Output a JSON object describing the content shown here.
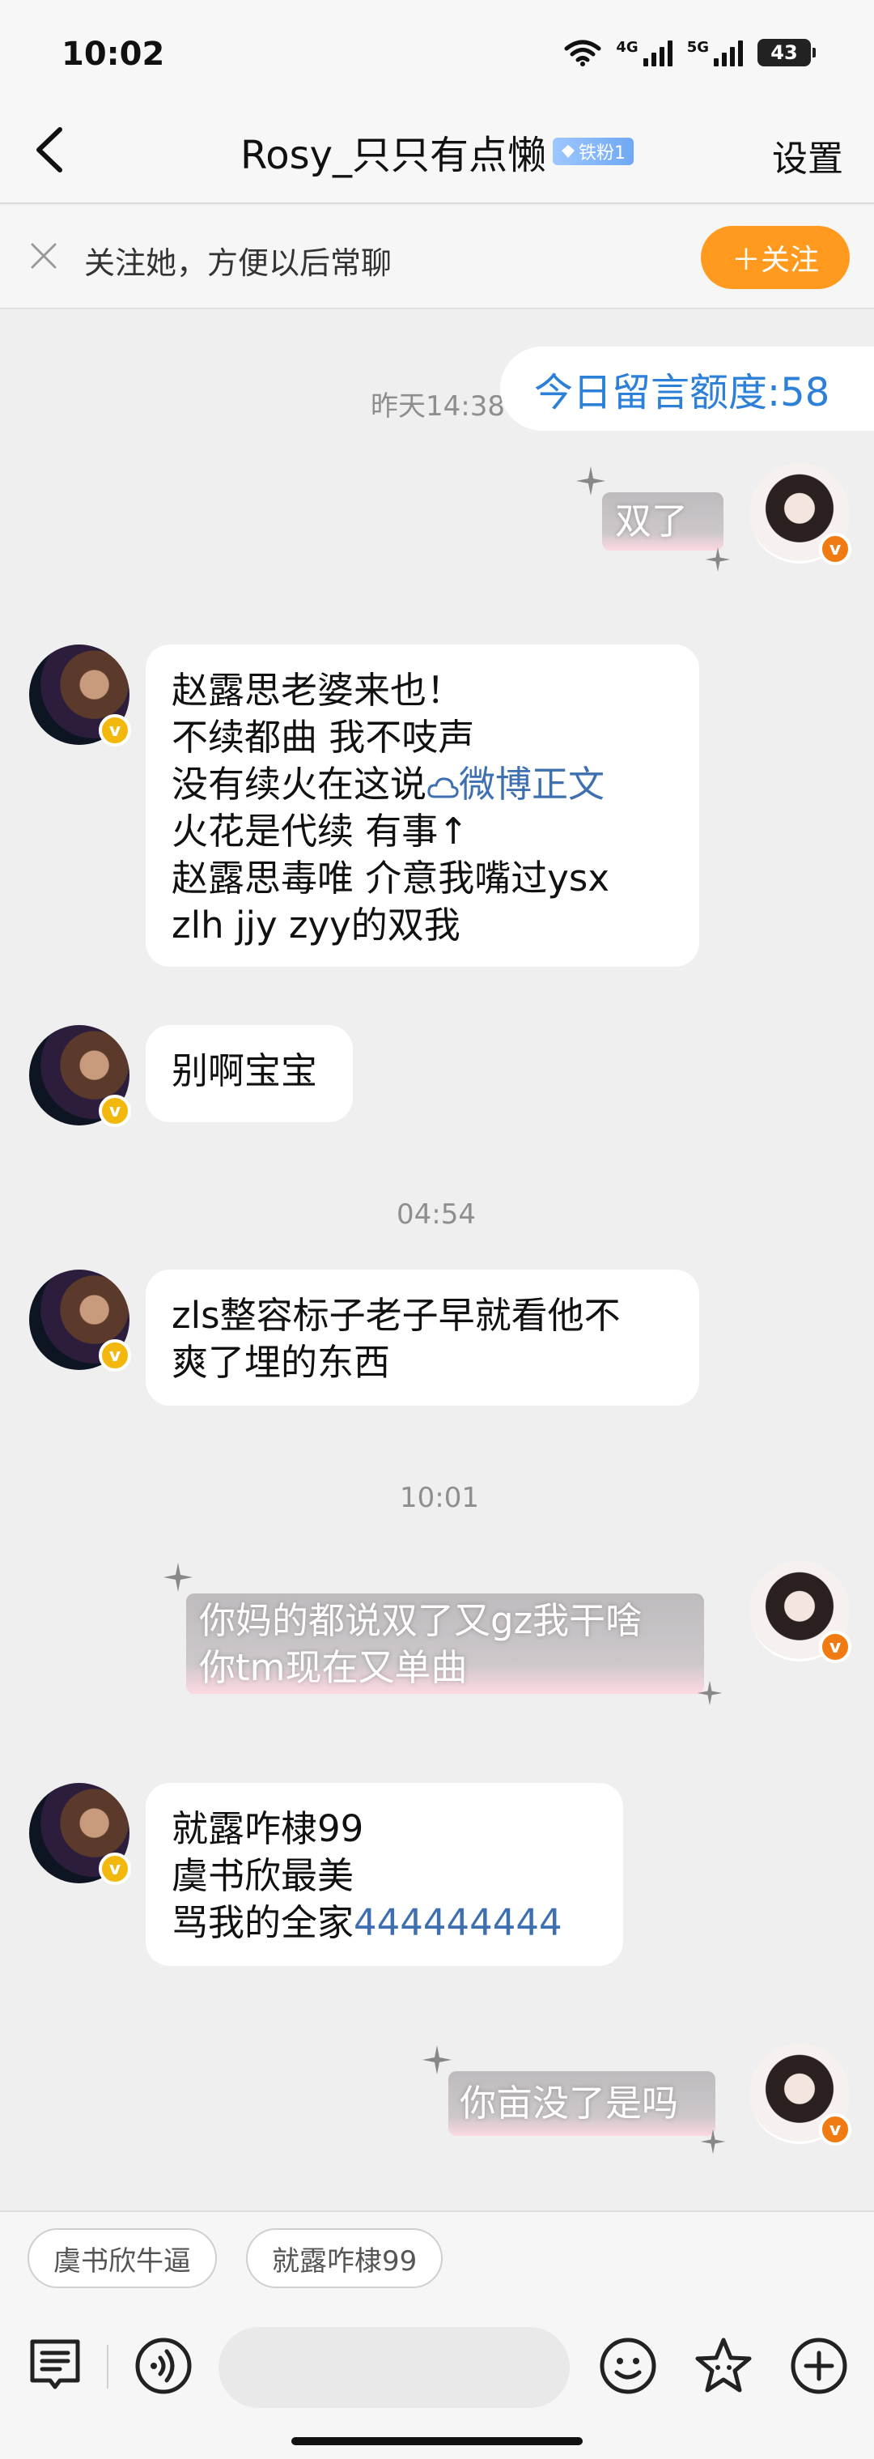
{
  "status": {
    "time": "10:02",
    "net1": "4G",
    "net2": "5G",
    "battery": "43"
  },
  "header": {
    "title": "Rosy_只只有点懒",
    "badge": "铁粉1",
    "settings": "设置"
  },
  "follow_bar": {
    "text": "关注她，方便以后常聊",
    "button": "＋关注"
  },
  "quota": {
    "timestamp": "昨天14:38",
    "label": "今日留言额度:58"
  },
  "messages": {
    "m1": {
      "text": "双了"
    },
    "m2": {
      "line1": "赵露思老婆来也！",
      "line2": "不续都曲 我不吱声",
      "line3_prefix": "没有续火在这说",
      "line3_link": "微博正文",
      "line4": "火花是代续 有事↑",
      "line5": "赵露思毒唯 介意我嘴过ysx",
      "line6": "zlh jjy zyy的双我"
    },
    "m3": {
      "text": "别啊宝宝"
    },
    "ts2": "04:54",
    "m4": {
      "line1": "zls整容标子老子早就看他不",
      "line2": "爽了埋的东西"
    },
    "ts3": "10:01",
    "m5": {
      "line1": "你妈的都说双了又gz我干啥",
      "line2": "你tm现在又单曲"
    },
    "m6": {
      "line1": "就露咋棣99",
      "line2": "虞书欣最美",
      "line3_prefix": "骂我的全家",
      "line3_link": "444444444"
    },
    "m7": {
      "text": "你亩没了是吗"
    }
  },
  "quick_replies": [
    "虞书欣牛逼",
    "就露咋棣99"
  ],
  "colors": {
    "follow_orange": "#ff9a1e",
    "link_blue": "#3e6fb0",
    "quota_blue": "#2d80d8",
    "verified_gold": "#f3b80d",
    "verified_orange": "#f07b12"
  }
}
